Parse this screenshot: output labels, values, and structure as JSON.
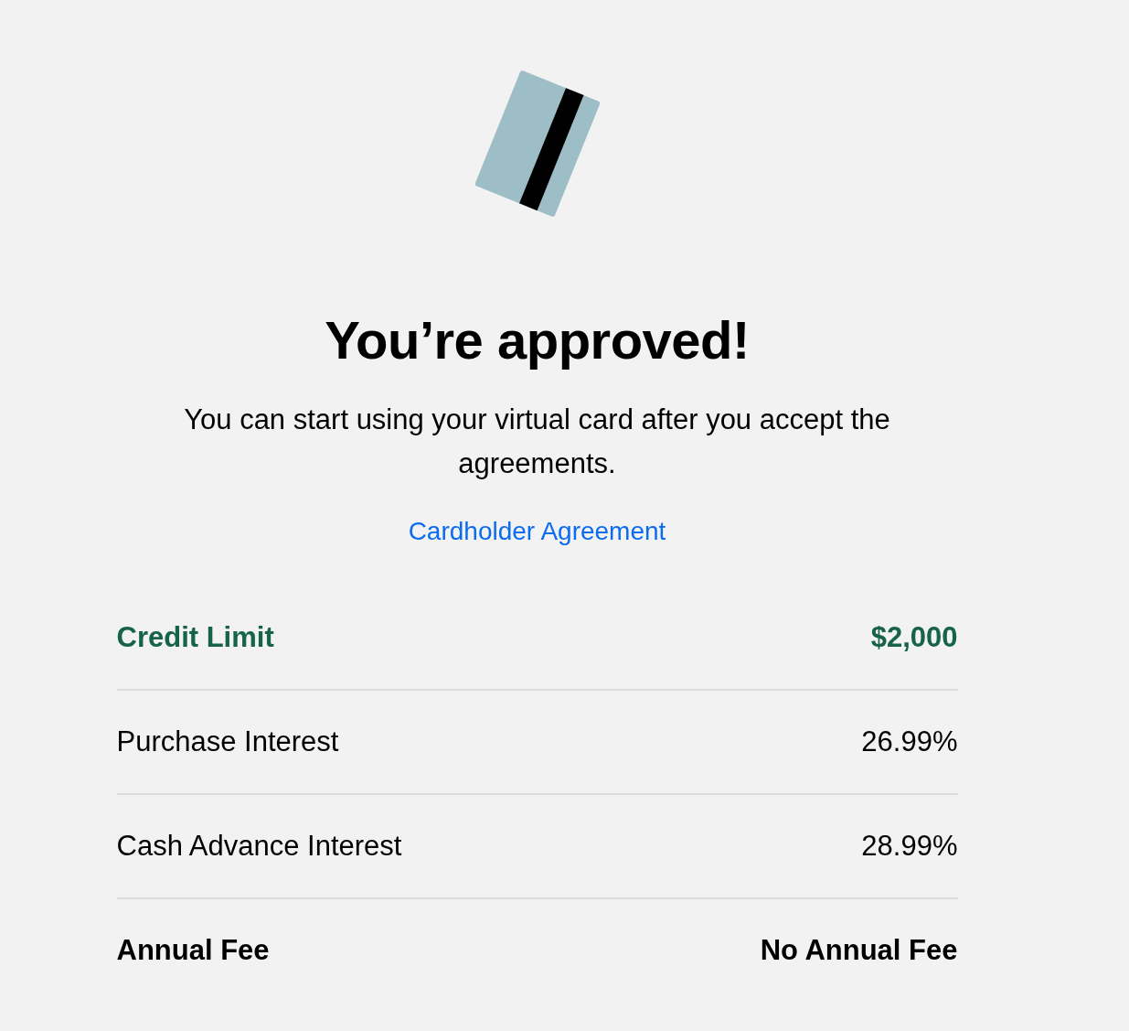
{
  "heading": "You’re approved!",
  "message": "You can start using your virtual card after you accept the agreements.",
  "links": [
    {
      "label": "Cardholder Agreement"
    }
  ],
  "terms": [
    {
      "kind": "highlight",
      "label": "Credit Limit",
      "value": "$2,000"
    },
    {
      "kind": "plain",
      "label": "Purchase Interest",
      "value": "26.99%"
    },
    {
      "kind": "plain",
      "label": "Cash Advance Interest",
      "value": "28.99%"
    },
    {
      "kind": "strong",
      "label": "Annual Fee",
      "value": "No Annual Fee"
    }
  ]
}
